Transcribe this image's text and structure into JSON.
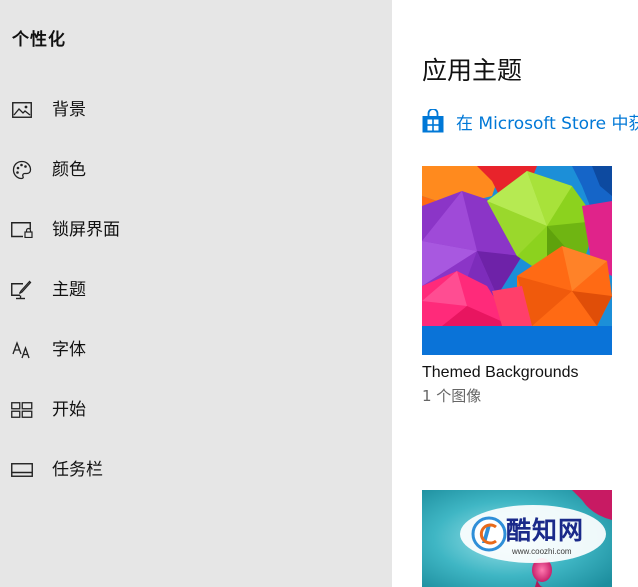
{
  "sidebar": {
    "title": "个性化",
    "items": [
      {
        "label": "背景",
        "icon": "picture-icon"
      },
      {
        "label": "颜色",
        "icon": "palette-icon"
      },
      {
        "label": "锁屏界面",
        "icon": "lock-screen-icon"
      },
      {
        "label": "主题",
        "icon": "theme-brush-icon"
      },
      {
        "label": "字体",
        "icon": "font-icon"
      },
      {
        "label": "开始",
        "icon": "start-tiles-icon"
      },
      {
        "label": "任务栏",
        "icon": "taskbar-icon"
      }
    ]
  },
  "main": {
    "title": "应用主题",
    "store_link": "在 Microsoft Store 中获",
    "themes": [
      {
        "name": "Themed Backgrounds",
        "count": "1 个图像"
      }
    ]
  },
  "watermark": {
    "text": "酷知网",
    "url": "www.coozhi.com"
  },
  "colors": {
    "sidebar_bg": "#e6e6e6",
    "accent": "#0078d7",
    "theme_bar": "#0a73d8"
  }
}
